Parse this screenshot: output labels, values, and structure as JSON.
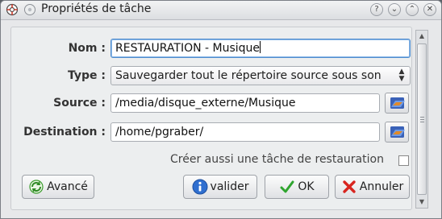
{
  "window": {
    "title": "Propriétés de tâche",
    "buttons": {
      "help": "?",
      "shade": "⌄",
      "maximize": "⌃",
      "close": "✕"
    }
  },
  "form": {
    "name_label": "Nom :",
    "name_value": "RESTAURATION - Musique",
    "type_label": "Type :",
    "type_value": "Sauvegarder tout le répertoire source sous son",
    "source_label": "Source :",
    "source_value": "/media/disque_externe/Musique",
    "destination_label": "Destination :",
    "destination_value": "/home/pgraber/",
    "restore_checkbox_label": "Créer aussi une tâche de restauration",
    "restore_checked": false
  },
  "actions": {
    "advanced": "Avancé",
    "validate": "valider",
    "ok": "OK",
    "cancel": "Annuler"
  },
  "colors": {
    "window_bg": "#e7e8ea",
    "focus_border": "#4f8ccd",
    "ok_check": "#2fa52f",
    "cancel_x": "#d8251f",
    "info_blue": "#2f6fd0"
  },
  "icons": {
    "app": "app-lifebuoy-icon",
    "menu": "window-menu-icon",
    "browse": "folder-browse-icon",
    "advanced": "refresh-arrows-icon",
    "validate": "info-icon",
    "ok": "checkmark-icon",
    "cancel": "x-mark-icon"
  }
}
